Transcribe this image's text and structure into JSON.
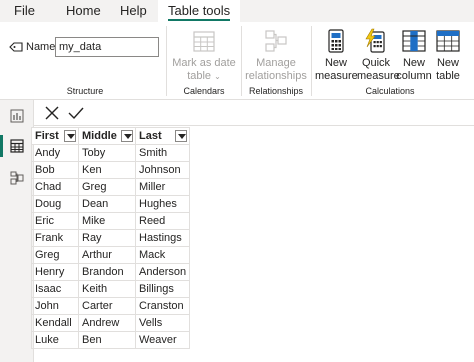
{
  "menu": {
    "tabs": [
      {
        "label": "File"
      },
      {
        "label": "Home"
      },
      {
        "label": "Help"
      },
      {
        "label": "Table tools"
      }
    ]
  },
  "ribbon": {
    "structure": {
      "name_label": "Name",
      "name_value": "my_data",
      "group_label": "Structure"
    },
    "calendars": {
      "mark_as_date_line1": "Mark as date",
      "mark_as_date_line2": "table",
      "group_label": "Calendars"
    },
    "relationships": {
      "manage_line1": "Manage",
      "manage_line2": "relationships",
      "group_label": "Relationships"
    },
    "calculations": {
      "new_measure_line1": "New",
      "new_measure_line2": "measure",
      "quick_measure_line1": "Quick",
      "quick_measure_line2": "measure",
      "new_column_line1": "New",
      "new_column_line2": "column",
      "new_table_line1": "New",
      "new_table_line2": "table",
      "group_label": "Calculations"
    }
  },
  "colors": {
    "accent": "#117865",
    "icon_blue": "#1f6fc5",
    "icon_yellow": "#f2c811",
    "disabled": "#a19f9d"
  },
  "icons": {
    "name": "tag-icon",
    "cancel": "close-icon",
    "commit": "check-icon",
    "report_view": "bar-chart-icon",
    "data_view": "table-icon",
    "model_view": "model-icon"
  },
  "table": {
    "columns": [
      "First",
      "Middle",
      "Last"
    ],
    "rows": [
      [
        "Andy",
        "Toby",
        "Smith"
      ],
      [
        "Bob",
        "Ken",
        "Johnson"
      ],
      [
        "Chad",
        "Greg",
        "Miller"
      ],
      [
        "Doug",
        "Dean",
        "Hughes"
      ],
      [
        "Eric",
        "Mike",
        "Reed"
      ],
      [
        "Frank",
        "Ray",
        "Hastings"
      ],
      [
        "Greg",
        "Arthur",
        "Mack"
      ],
      [
        "Henry",
        "Brandon",
        "Anderson"
      ],
      [
        "Isaac",
        "Keith",
        "Billings"
      ],
      [
        "John",
        "Carter",
        "Cranston"
      ],
      [
        "Kendall",
        "Andrew",
        "Vells"
      ],
      [
        "Luke",
        "Ben",
        "Weaver"
      ]
    ]
  }
}
